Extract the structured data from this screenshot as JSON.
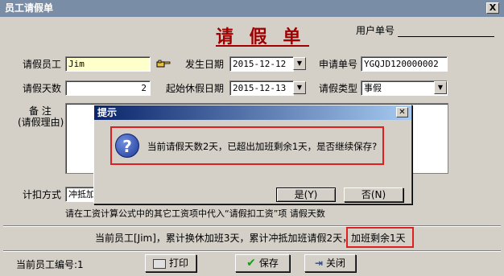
{
  "window": {
    "title": "员工请假单",
    "close_label": "X"
  },
  "form": {
    "title": "请 假 单",
    "user_no_label": "用户单号"
  },
  "fields": {
    "employee_label": "请假员工",
    "employee_value": "Jim",
    "date_label": "发生日期",
    "date_value": "2015-12-12",
    "apply_no_label": "申请单号",
    "apply_no_value": "YGQJD120000002",
    "days_label": "请假天数",
    "days_value": "2",
    "start_date_label": "起始休假日期",
    "start_date_value": "2015-12-13",
    "type_label": "请假类型",
    "type_value": "事假",
    "remark_label_1": "备    注",
    "remark_label_2": "(请假理由)",
    "deduct_label": "计扣方式",
    "deduct_value": "冲抵加",
    "hint_text": "请在工资计算公式中的其它工资项中代入“请假扣工资”项 请假天数"
  },
  "status": {
    "summary": "当前员工[Jim]，累计换休加班3天，累计冲抵加班请假2天，",
    "remain": "加班剩余1天"
  },
  "footer": {
    "emp_no_label": "当前员工编号:",
    "emp_no_value": "1",
    "print_label": "打印",
    "save_label": "保存",
    "close_label": "关闭"
  },
  "dialog": {
    "title": "提示",
    "message": "当前请假天数2天，已超出加班剩余1天，是否继续保存?",
    "yes_label": "是(Y)",
    "no_label": "否(N)"
  },
  "colors": {
    "form_title": "#a00000",
    "highlight_box": "#e02020",
    "dialog_title": "#0a246a"
  }
}
